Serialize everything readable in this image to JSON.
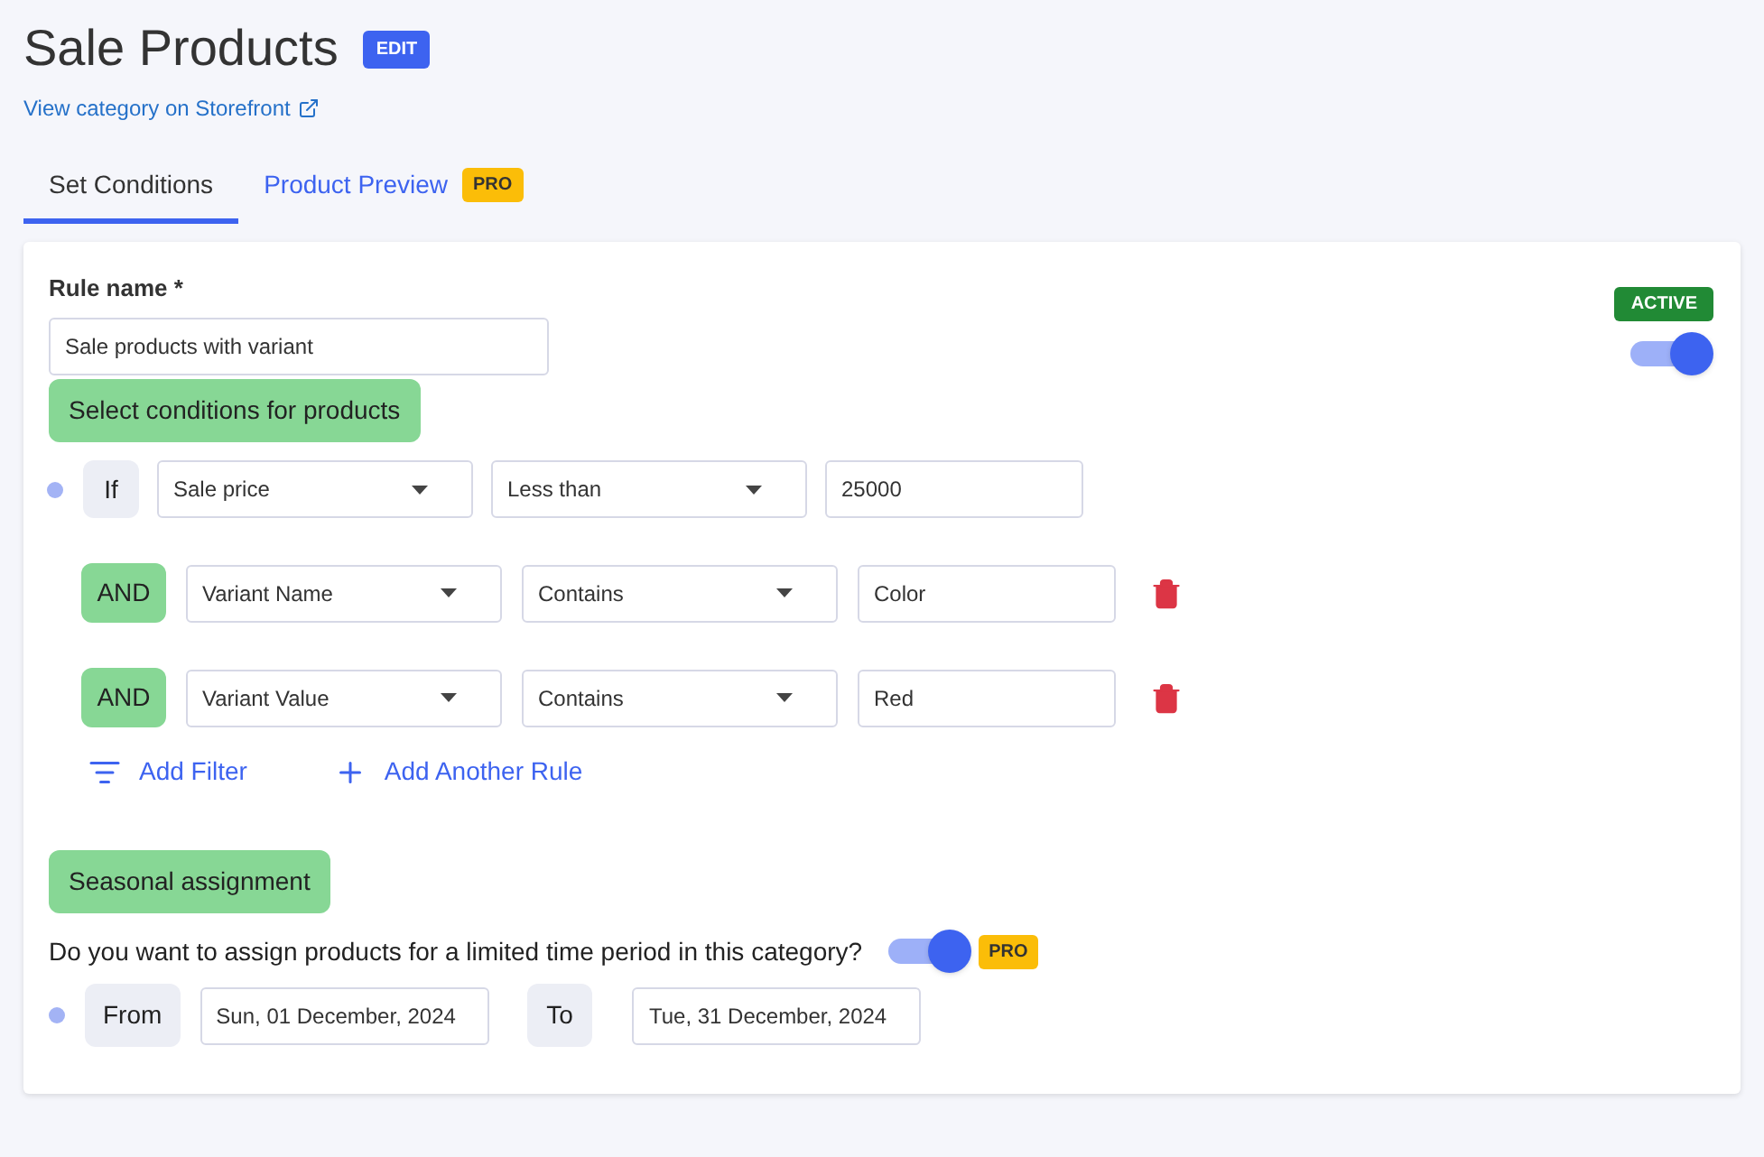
{
  "header": {
    "title": "Sale Products",
    "edit_badge": "EDIT",
    "storefront_link": "View category on Storefront"
  },
  "tabs": [
    {
      "label": "Set Conditions",
      "selected": true
    },
    {
      "label": "Product Preview",
      "selected": false,
      "badge": "PRO"
    }
  ],
  "rule": {
    "label": "Rule name *",
    "value": "Sale products with variant",
    "status": "ACTIVE",
    "on": true
  },
  "conditions_heading": "Select conditions for products",
  "conditions": [
    {
      "kind": "if",
      "connector": "If",
      "field": "Sale price",
      "operator": "Less than",
      "value": "25000"
    },
    {
      "kind": "and",
      "connector": "AND",
      "field": "Variant Name",
      "operator": "Contains",
      "value": "Color"
    },
    {
      "kind": "and",
      "connector": "AND",
      "field": "Variant Value",
      "operator": "Contains",
      "value": "Red"
    }
  ],
  "actions": [
    {
      "kind": "filter",
      "label": "Add Filter"
    },
    {
      "kind": "add",
      "label": "Add Another Rule"
    }
  ],
  "seasonal": {
    "heading": "Seasonal assignment",
    "question": "Do you want to assign products for a limited time period in this category?",
    "on": true,
    "badge": "PRO",
    "from_label": "From",
    "from_value": "Sun, 01 December, 2024",
    "to_label": "To",
    "to_value": "Tue, 31 December, 2024"
  }
}
